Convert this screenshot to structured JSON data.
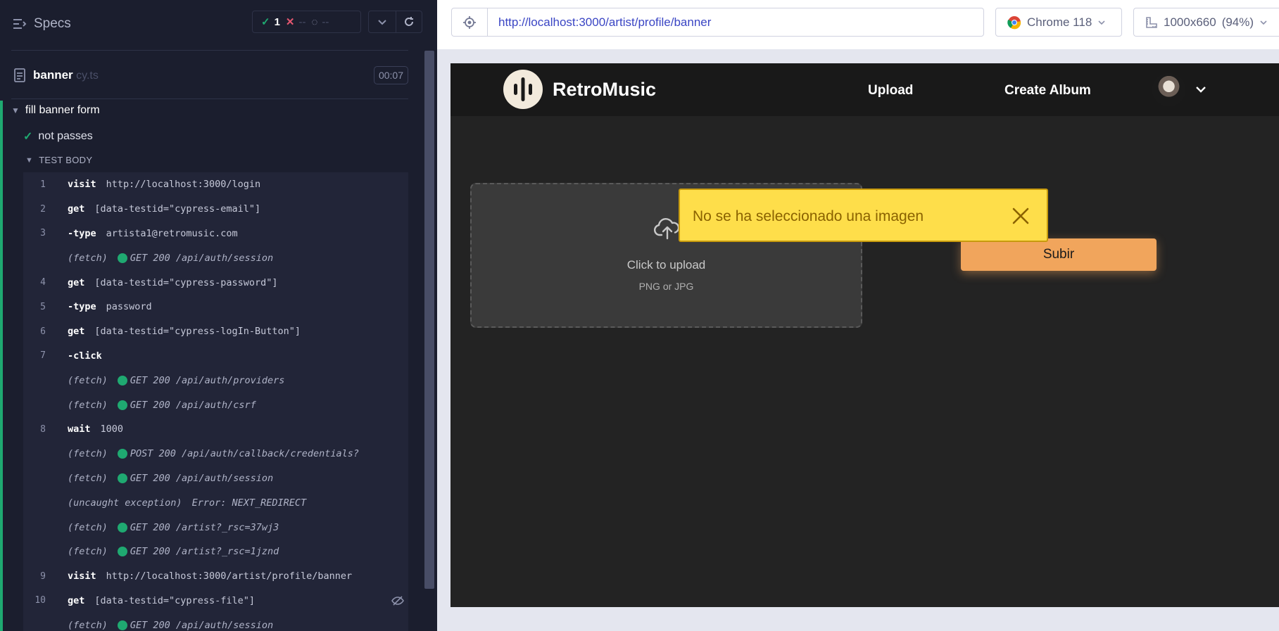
{
  "reporter": {
    "specs_label": "Specs",
    "stats": {
      "passed": "1",
      "failed": "--",
      "pending": "--"
    },
    "spec": {
      "name": "banner",
      "ext": " cy.ts",
      "duration": "00:07"
    },
    "suite_title": "fill banner form",
    "test_title": "not passes",
    "test_body_label": "TEST BODY",
    "commands": [
      {
        "num": "1",
        "name": "visit",
        "msg": "http://localhost:3000/login"
      },
      {
        "num": "2",
        "name": "get",
        "msg": "[data-testid=\"cypress-email\"]"
      },
      {
        "num": "3",
        "name": "-type",
        "msg": "artista1@retromusic.com"
      },
      {
        "num": "",
        "kind": "fetch",
        "label": "(fetch)",
        "req": "GET 200 /api/auth/session"
      },
      {
        "num": "4",
        "name": "get",
        "msg": "[data-testid=\"cypress-password\"]"
      },
      {
        "num": "5",
        "name": "-type",
        "msg": "password"
      },
      {
        "num": "6",
        "name": "get",
        "msg": "[data-testid=\"cypress-logIn-Button\"]"
      },
      {
        "num": "7",
        "name": "-click",
        "msg": ""
      },
      {
        "num": "",
        "kind": "fetch",
        "label": "(fetch)",
        "req": "GET 200 /api/auth/providers"
      },
      {
        "num": "",
        "kind": "fetch",
        "label": "(fetch)",
        "req": "GET 200 /api/auth/csrf"
      },
      {
        "num": "8",
        "name": "wait",
        "msg": "1000"
      },
      {
        "num": "",
        "kind": "fetch",
        "label": "(fetch)",
        "req": "POST 200 /api/auth/callback/credentials?"
      },
      {
        "num": "",
        "kind": "fetch",
        "label": "(fetch)",
        "req": "GET 200 /api/auth/session"
      },
      {
        "num": "",
        "kind": "exception",
        "label": "(uncaught exception)",
        "req": "Error: NEXT_REDIRECT"
      },
      {
        "num": "",
        "kind": "fetch",
        "label": "(fetch)",
        "req": "GET 200 /artist?_rsc=37wj3"
      },
      {
        "num": "",
        "kind": "fetch",
        "label": "(fetch)",
        "req": "GET 200 /artist?_rsc=1jznd"
      },
      {
        "num": "9",
        "name": "visit",
        "msg": "http://localhost:3000/artist/profile/banner"
      },
      {
        "num": "10",
        "name": "get",
        "msg": "[data-testid=\"cypress-file\"]",
        "hidden": true
      },
      {
        "num": "",
        "kind": "fetch",
        "label": "(fetch)",
        "req": "GET 200 /api/auth/session"
      }
    ]
  },
  "browser": {
    "url": "http://localhost:3000/artist/profile/banner",
    "browser_name": "Chrome 118",
    "viewport": "1000x660",
    "zoom": "(94%)"
  },
  "app": {
    "brand": "RetroMusic",
    "nav": {
      "upload": "Upload",
      "create_album": "Create Album"
    },
    "dropzone": {
      "hint": "Click to upload",
      "types": "PNG or JPG"
    },
    "submit_label": "Subir",
    "toast_message": "No se ha seleccionado una imagen"
  },
  "colors": {
    "pass": "#1fa971",
    "fail": "#e45770",
    "toast_bg": "#fede4a",
    "submit_bg": "#f1a55c",
    "url": "#3a45c4"
  }
}
